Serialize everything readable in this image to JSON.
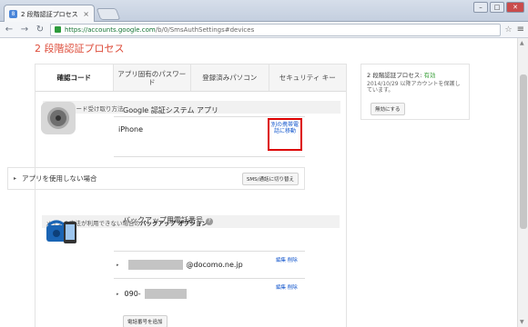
{
  "browser": {
    "tab_title": "2 段階認証プロセス",
    "tab_favicon": "8",
    "url_host": "https://accounts.google.com",
    "url_path": "/b/0/SmsAuthSettings#devices"
  },
  "page": {
    "title": "2 段階認証プロセス",
    "tabs": [
      {
        "label": "確認コード"
      },
      {
        "label": "アプリ固有のパスワード"
      },
      {
        "label": "登録済みパソコン"
      },
      {
        "label": "セキュリティ キー"
      }
    ],
    "main_section_header": "メインのコード受け取り方法",
    "app_name": "Google 認証システム アプリ",
    "device_name": "iPhone",
    "move_link": "別の携帯電話に移動",
    "no_app": {
      "label": "アプリを使用しない場合",
      "button": "SMS/通話に切り替え"
    },
    "backup_header_pre": "メインの方法が利用できない場合の",
    "backup_header_bold": "バックアップ オプション",
    "backup_title": "バックアップ用電話番号",
    "help_icon_glyph": "?",
    "phones": [
      {
        "prefix": "",
        "suffix": "@docomo.ne.jp",
        "edit": "編集",
        "delete": "削除"
      },
      {
        "prefix": "090-",
        "suffix": "",
        "edit": "編集",
        "delete": "削除"
      }
    ],
    "add_phone_button": "電話番号を追加"
  },
  "sidebar": {
    "status_label": "2 段階認証プロセス:",
    "status_value": "有効",
    "since_text": "2014/10/29 以降アカウントを保護しています。",
    "disable_button": "無効にする"
  },
  "colors": {
    "title_red": "#dd4b39",
    "link_blue": "#1155cc",
    "status_green": "#3a9f3a",
    "highlight_box": "#dd0000"
  }
}
